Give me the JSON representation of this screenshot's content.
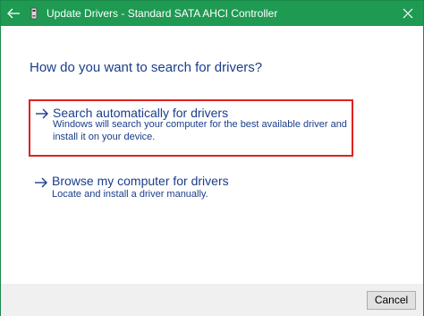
{
  "window": {
    "title": "Update Drivers - Standard SATA AHCI Controller"
  },
  "icons": {
    "back": "back-arrow-icon",
    "driver": "driver-device-icon",
    "close": "close-icon",
    "option_arrow": "right-arrow-icon"
  },
  "main": {
    "heading": "How do you want to search for drivers?",
    "options": [
      {
        "title": "Search automatically for drivers",
        "description": "Windows will search your computer for the best available driver and install it on your device.",
        "highlighted": true
      },
      {
        "title": "Browse my computer for drivers",
        "description": "Locate and install a driver manually.",
        "highlighted": false
      }
    ]
  },
  "footer": {
    "cancel_label": "Cancel"
  },
  "colors": {
    "titlebar": "#1e9a52",
    "link_text": "#1a3d8a",
    "highlight_border": "#e02020",
    "footer_bg": "#f0f0f0"
  }
}
